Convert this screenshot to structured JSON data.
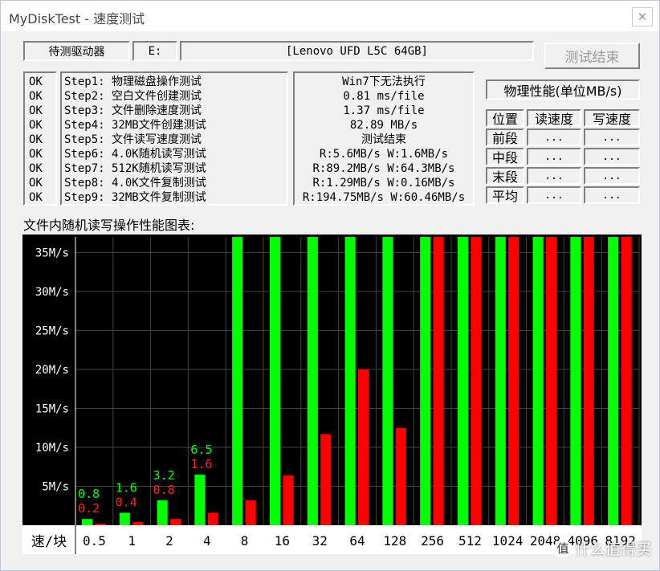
{
  "window": {
    "title": "MyDiskTest - 速度测试",
    "close": "✕"
  },
  "drive": {
    "label": "待测驱动器",
    "letter": "E:",
    "name": "[Lenovo UFD L5C 64GB]"
  },
  "buttons": {
    "end_test": "测试结束"
  },
  "steps": [
    {
      "status": "OK",
      "label": "Step1: 物理磁盘操作测试",
      "result": "Win7下无法执行"
    },
    {
      "status": "OK",
      "label": "Step2: 空白文件创建测试",
      "result": "0.81 ms/file"
    },
    {
      "status": "OK",
      "label": "Step3: 文件删除速度测试",
      "result": "1.37 ms/file"
    },
    {
      "status": "OK",
      "label": "Step4: 32MB文件创建测试",
      "result": "82.89 MB/s"
    },
    {
      "status": "OK",
      "label": "Step5: 文件读写速度测试",
      "result": "测试结束"
    },
    {
      "status": "OK",
      "label": "Step6: 4.0K随机读写测试",
      "result": "R:5.6MB/s W:1.6MB/s"
    },
    {
      "status": "OK",
      "label": "Step7: 512K随机读写测试",
      "result": "R:89.2MB/s W:64.3MB/s"
    },
    {
      "status": "OK",
      "label": "Step8: 4.0K文件复制测试",
      "result": "R:1.29MB/s W:0.16MB/s"
    },
    {
      "status": "OK",
      "label": "Step9: 32MB文件复制测试",
      "result": "R:194.75MB/s W:60.46MB/s"
    }
  ],
  "perf": {
    "title": "物理性能(单位MB/s)",
    "headers": [
      "位置",
      "读速度",
      "写速度"
    ],
    "rows": [
      {
        "pos": "前段",
        "read": "...",
        "write": "..."
      },
      {
        "pos": "中段",
        "read": "...",
        "write": "..."
      },
      {
        "pos": "末段",
        "read": "...",
        "write": "..."
      },
      {
        "pos": "平均",
        "read": "...",
        "write": "..."
      }
    ]
  },
  "chart_title": "文件内随机读写操作性能图表:",
  "chart_data": {
    "type": "bar",
    "title": "文件内随机读写操作性能图表:",
    "xlabel": "速/块",
    "ylabel": "",
    "categories": [
      "0.5",
      "1",
      "2",
      "4",
      "8",
      "16",
      "32",
      "64",
      "128",
      "256",
      "512",
      "1024",
      "2048",
      "4096",
      "8192"
    ],
    "y_ticks": [
      "5M/s",
      "10M/s",
      "15M/s",
      "20M/s",
      "25M/s",
      "30M/s",
      "35M/s"
    ],
    "ylim": [
      0,
      37
    ],
    "grid": true,
    "series": [
      {
        "color": "#00ff00",
        "values": [
          0.8,
          1.6,
          3.2,
          6.5,
          37,
          37,
          37,
          37,
          37,
          37,
          37,
          37,
          37,
          37,
          37
        ]
      },
      {
        "color": "#ff0000",
        "values": [
          0.2,
          0.4,
          0.8,
          1.6,
          3.2,
          6.4,
          11.7,
          20.0,
          12.5,
          37,
          37,
          37,
          37,
          37,
          37
        ]
      }
    ],
    "data_labels": {
      "read": [
        "0.8",
        "1.6",
        "3.2",
        "6.5"
      ],
      "write": [
        "0.2",
        "0.4",
        "0.8",
        "1.6"
      ]
    }
  },
  "watermark": {
    "logo": "值",
    "text": "什么值得买"
  }
}
